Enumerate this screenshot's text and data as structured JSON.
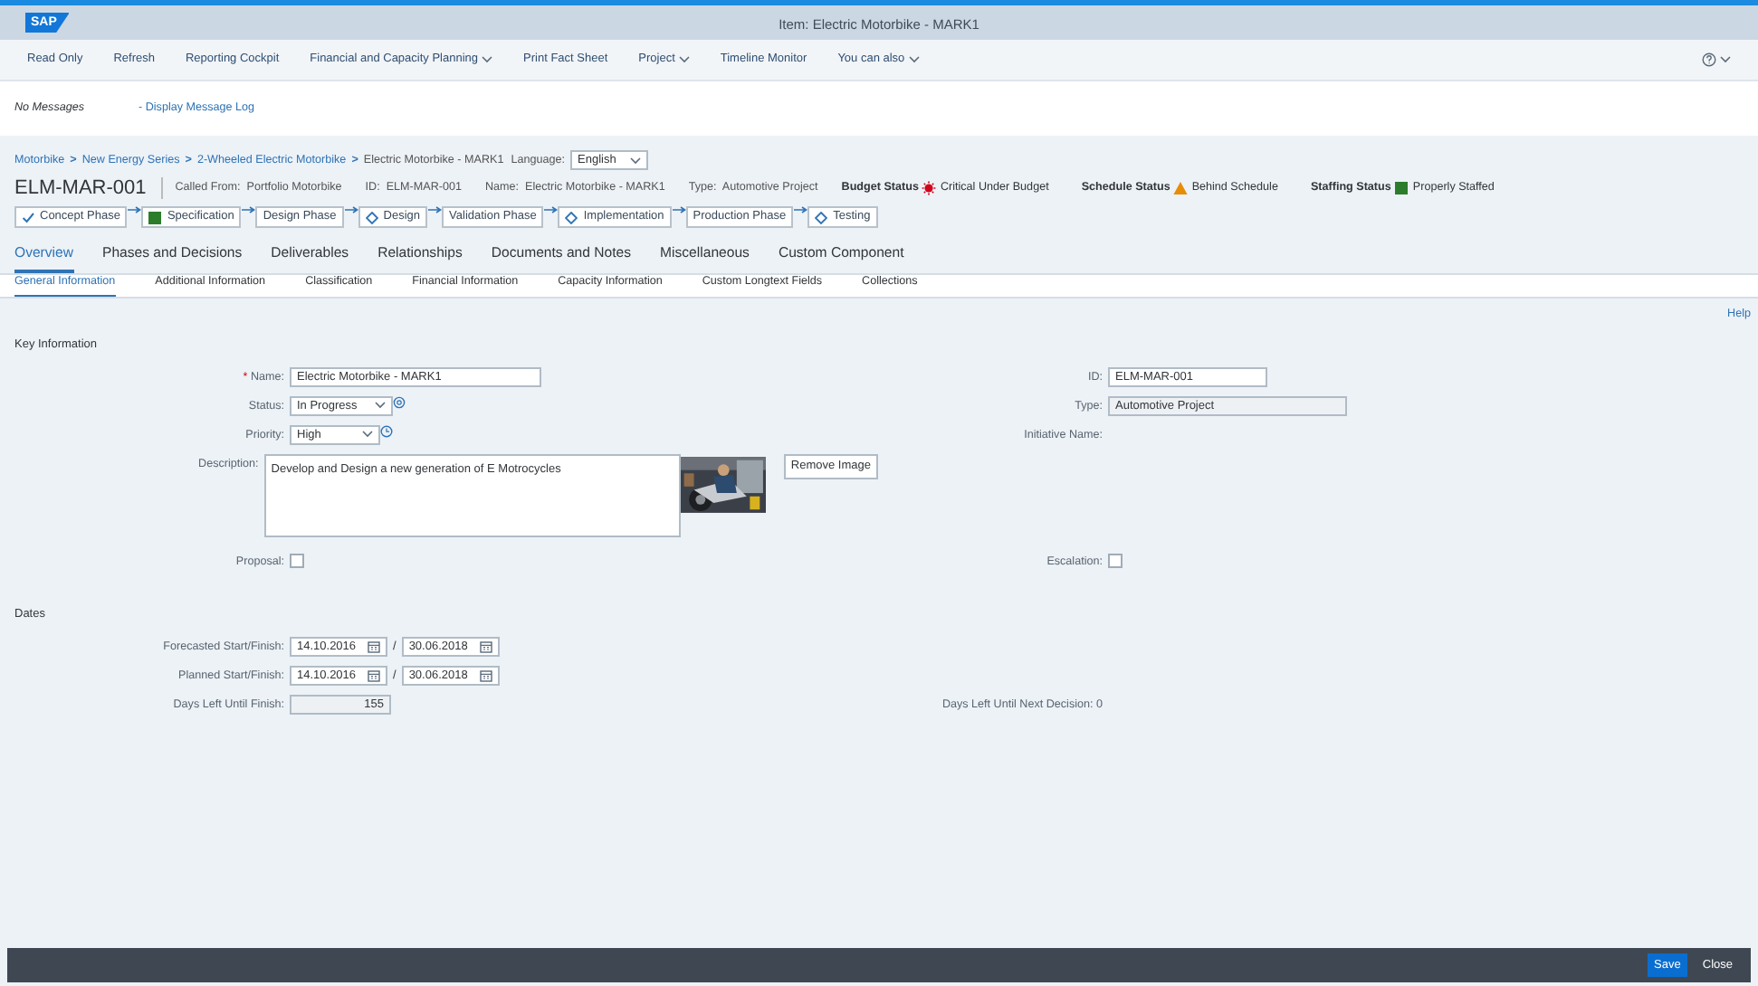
{
  "shell": {
    "logo": "SAP",
    "title": "Item: Electric Motorbike - MARK1"
  },
  "toolbar": [
    {
      "label": "Read Only",
      "menu": false
    },
    {
      "label": "Refresh",
      "menu": false
    },
    {
      "label": "Reporting Cockpit",
      "menu": false
    },
    {
      "label": "Financial and Capacity Planning",
      "menu": true
    },
    {
      "label": "Print Fact Sheet",
      "menu": false
    },
    {
      "label": "Project",
      "menu": true
    },
    {
      "label": "Timeline Monitor",
      "menu": false
    },
    {
      "label": "You can also",
      "menu": true
    }
  ],
  "messages": {
    "text": "No Messages",
    "link": "- Display Message Log"
  },
  "breadcrumb": [
    {
      "kind": "link",
      "label": "Motorbike"
    },
    {
      "kind": "separator",
      "label": ">"
    },
    {
      "kind": "link",
      "label": "New Energy Series"
    },
    {
      "kind": "separator",
      "label": ">"
    },
    {
      "kind": "link",
      "label": "2-Wheeled Electric Motorbike"
    },
    {
      "kind": "separator",
      "label": ">"
    },
    {
      "kind": "current",
      "label": "Electric Motorbike - MARK1"
    }
  ],
  "language": {
    "label": "Language:",
    "value": "English"
  },
  "header": {
    "id": "ELM-MAR-001",
    "attributes": [
      {
        "label": "Called From:",
        "value": "Portfolio Motorbike"
      },
      {
        "label": "ID:",
        "value": "ELM-MAR-001"
      },
      {
        "label": "Name:",
        "value": "Electric Motorbike - MARK1"
      },
      {
        "label": "Type:",
        "value": "Automotive Project"
      }
    ],
    "statuses": [
      {
        "label": "Budget Status",
        "value": "Critical Under Budget",
        "kind": "critical",
        "color": "#d0021b"
      },
      {
        "label": "Schedule Status",
        "value": "Behind Schedule",
        "kind": "warning",
        "color": "#e78c07"
      },
      {
        "label": "Staffing Status",
        "value": "Properly Staffed",
        "kind": "square",
        "color": "#2b7d2b"
      }
    ]
  },
  "phases": [
    {
      "label": "Concept Phase",
      "kind": "check"
    },
    {
      "label": "Specification",
      "kind": "square"
    },
    {
      "label": "Design Phase",
      "kind": "plain"
    },
    {
      "label": "Design",
      "kind": "diamond"
    },
    {
      "label": "Validation Phase",
      "kind": "plain"
    },
    {
      "label": "Implementation",
      "kind": "diamond"
    },
    {
      "label": "Production Phase",
      "kind": "plain"
    },
    {
      "label": "Testing",
      "kind": "diamond"
    }
  ],
  "tabs": [
    {
      "label": "Overview",
      "selected": true
    },
    {
      "label": "Phases and Decisions",
      "selected": false
    },
    {
      "label": "Deliverables",
      "selected": false
    },
    {
      "label": "Relationships",
      "selected": false
    },
    {
      "label": "Documents and Notes",
      "selected": false
    },
    {
      "label": "Miscellaneous",
      "selected": false
    },
    {
      "label": "Custom Component",
      "selected": false
    }
  ],
  "subtabs": [
    {
      "label": "General Information",
      "selected": true
    },
    {
      "label": "Additional Information",
      "selected": false
    },
    {
      "label": "Classification",
      "selected": false
    },
    {
      "label": "Financial Information",
      "selected": false
    },
    {
      "label": "Capacity Information",
      "selected": false
    },
    {
      "label": "Custom Longtext Fields",
      "selected": false
    },
    {
      "label": "Collections",
      "selected": false
    }
  ],
  "help": "Help",
  "sections": [
    {
      "title": "Key Information",
      "rows": [
        {
          "left": {
            "kind": "input",
            "label": "Name:",
            "value": "Electric Motorbike - MARK1",
            "required_mark": "*"
          },
          "right": {
            "kind": "input",
            "label": "ID:",
            "value": "ELM-MAR-001"
          }
        },
        {
          "left": {
            "kind": "select",
            "label": "Status:",
            "value": "In Progress"
          },
          "right": {
            "kind": "readonly",
            "label": "Type:",
            "value": "Automotive Project"
          }
        },
        {
          "left": {
            "kind": "select",
            "label": "Priority:",
            "value": "High"
          },
          "right": {
            "kind": "text",
            "label": "Initiative Name:"
          }
        },
        {
          "left": {
            "kind": "textarea",
            "label": "Description:",
            "value": "Develop and Design a new generation of E Motrocycles",
            "button": "Remove Image"
          }
        },
        {
          "left": {
            "kind": "checkbox",
            "label": "Proposal:",
            "checked": false
          },
          "right": {
            "kind": "checkbox",
            "label": "Escalation:",
            "checked": false
          }
        }
      ]
    },
    {
      "title": "Dates",
      "rows": [
        {
          "left": {
            "kind": "daterange",
            "label": "Forecasted Start/Finish:",
            "from": "14.10.2016",
            "separator": "/",
            "to": "30.06.2018"
          }
        },
        {
          "left": {
            "kind": "daterange",
            "label": "Planned Start/Finish:",
            "from": "14.10.2016",
            "separator": "/",
            "to": "30.06.2018"
          }
        },
        {
          "left": {
            "kind": "number",
            "label": "Days Left Until Finish:",
            "value": "155"
          },
          "right": {
            "kind": "text",
            "label": "Days Left Until Next Decision:",
            "value": "0"
          }
        }
      ]
    }
  ],
  "footer": [
    {
      "label": "Save",
      "kind": "emphasized"
    },
    {
      "label": "Close",
      "kind": "plain"
    }
  ]
}
